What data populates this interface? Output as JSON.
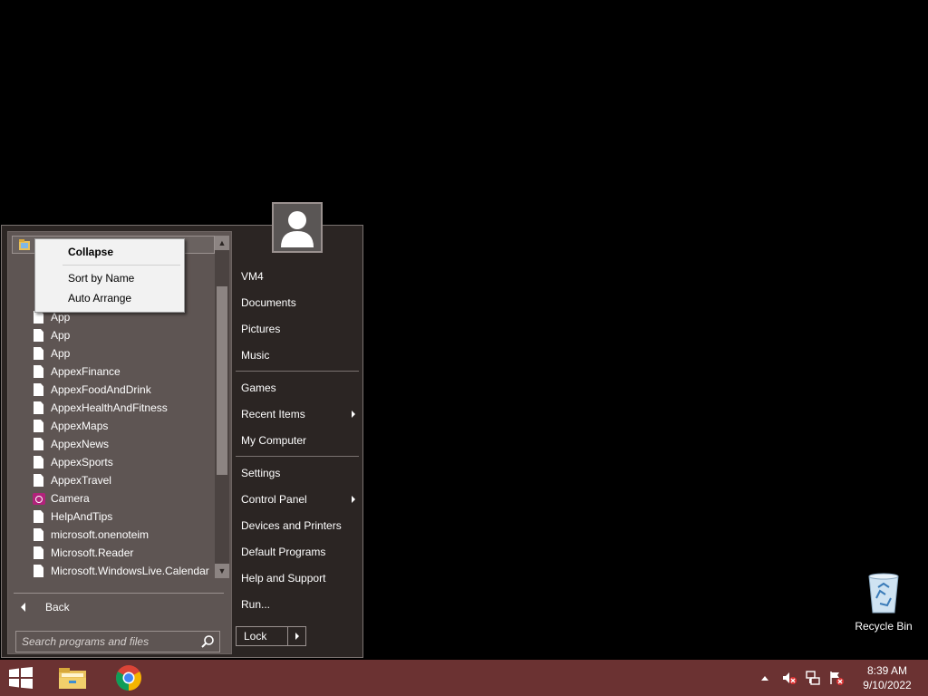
{
  "context_menu": {
    "collapse": "Collapse",
    "sort_by_name": "Sort by Name",
    "auto_arrange": "Auto Arrange"
  },
  "programs": [
    {
      "label": "App",
      "icon": "document-icon"
    },
    {
      "label": "App",
      "icon": "document-icon"
    },
    {
      "label": "App",
      "icon": "document-icon"
    },
    {
      "label": "AppexFinance",
      "icon": "document-icon"
    },
    {
      "label": "AppexFoodAndDrink",
      "icon": "document-icon"
    },
    {
      "label": "AppexHealthAndFitness",
      "icon": "document-icon"
    },
    {
      "label": "AppexMaps",
      "icon": "document-icon"
    },
    {
      "label": "AppexNews",
      "icon": "document-icon"
    },
    {
      "label": "AppexSports",
      "icon": "document-icon"
    },
    {
      "label": "AppexTravel",
      "icon": "document-icon"
    },
    {
      "label": "Camera",
      "icon": "camera-icon"
    },
    {
      "label": "HelpAndTips",
      "icon": "document-icon"
    },
    {
      "label": "microsoft.onenoteim",
      "icon": "document-icon"
    },
    {
      "label": "Microsoft.Reader",
      "icon": "document-icon"
    },
    {
      "label": "Microsoft.WindowsLive.Calendar",
      "icon": "document-icon"
    }
  ],
  "back_label": "Back",
  "search": {
    "placeholder": "Search programs and files"
  },
  "right_menu": {
    "vm4": "VM4",
    "documents": "Documents",
    "pictures": "Pictures",
    "music": "Music",
    "games": "Games",
    "recent_items": "Recent Items",
    "my_computer": "My Computer",
    "settings": "Settings",
    "control_panel": "Control Panel",
    "devices_printers": "Devices and Printers",
    "default_programs": "Default Programs",
    "help_support": "Help and Support",
    "run": "Run..."
  },
  "lock_label": "Lock",
  "desktop": {
    "recycle_bin": "Recycle Bin"
  },
  "clock": {
    "time": "8:39 AM",
    "date": "9/10/2022"
  },
  "colors": {
    "taskbar": "#6b3232",
    "menu_bg": "#2b2523",
    "left_pane": "#5e5553",
    "desktop": "#000000"
  }
}
